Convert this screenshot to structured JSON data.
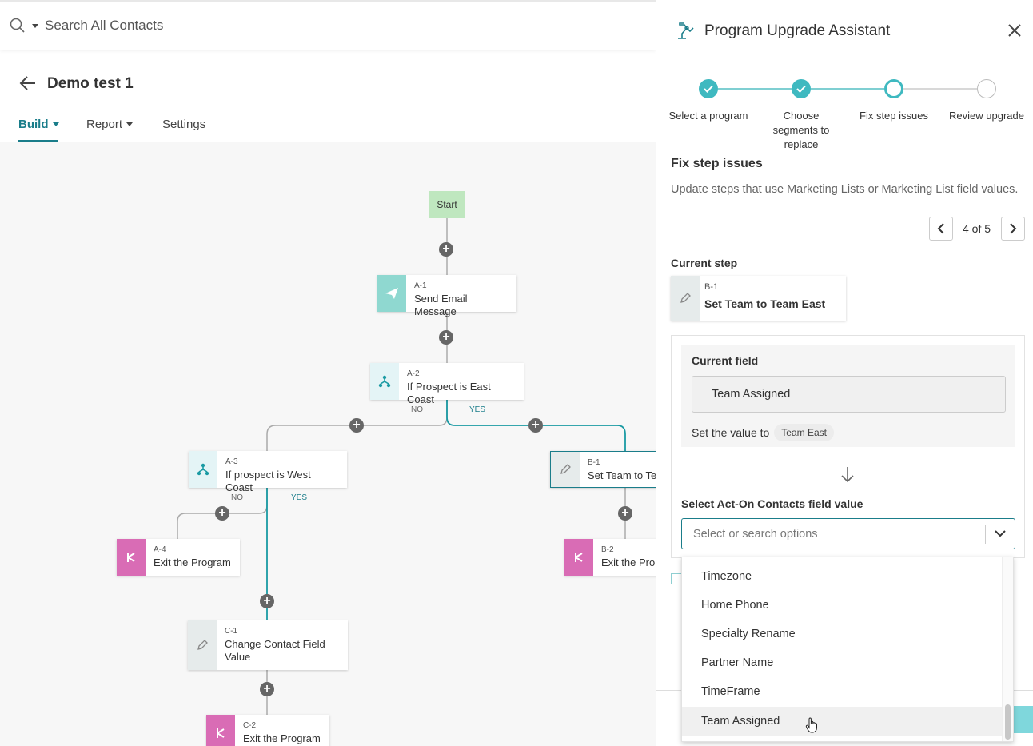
{
  "search": {
    "placeholder": "Search All Contacts"
  },
  "header": {
    "title": "Demo test 1",
    "tabs": [
      {
        "label": "Build",
        "active": true,
        "has_caret": true
      },
      {
        "label": "Report",
        "active": false,
        "has_caret": true
      },
      {
        "label": "Settings",
        "active": false,
        "has_caret": false
      }
    ]
  },
  "canvas": {
    "start_label": "Start",
    "nodes": [
      {
        "id": "A-1",
        "label": "Send Email Message",
        "icon": "paper-plane-icon"
      },
      {
        "id": "A-2",
        "label": "If Prospect is East Coast",
        "icon": "branch-icon"
      },
      {
        "id": "A-3",
        "label": "If prospect is West Coast",
        "icon": "branch-icon"
      },
      {
        "id": "A-4",
        "label": "Exit the Program",
        "icon": "exit-icon"
      },
      {
        "id": "B-1",
        "label": "Set Team to Te",
        "icon": "pencil-icon"
      },
      {
        "id": "B-2",
        "label": "Exit the Pro",
        "icon": "exit-icon"
      },
      {
        "id": "C-1",
        "label": "Change Contact Field Value",
        "icon": "pencil-icon"
      },
      {
        "id": "C-2",
        "label": "Exit the Program",
        "icon": "exit-icon"
      }
    ],
    "branch_labels": {
      "no": "NO",
      "yes": "YES"
    }
  },
  "panel": {
    "title": "Program Upgrade Assistant",
    "steps": [
      {
        "label": "Select a program",
        "state": "done"
      },
      {
        "label": "Choose segments to replace",
        "state": "done"
      },
      {
        "label": "Fix step issues",
        "state": "current"
      },
      {
        "label": "Review upgrade",
        "state": "todo"
      }
    ],
    "section_title": "Fix step issues",
    "section_desc": "Update steps that use Marketing Lists or Marketing List field values.",
    "pager": {
      "text": "4 of 5"
    },
    "current_step_label": "Current step",
    "current_step": {
      "id": "B-1",
      "label": "Set Team to Team East"
    },
    "current_field_label": "Current field",
    "current_field_value": "Team Assigned",
    "set_value_text": "Set the value to",
    "set_value_pill": "Team East",
    "select_label": "Select Act-On Contacts field value",
    "select_placeholder": "Select or search options",
    "dropdown_options": [
      "Timezone",
      "Home Phone",
      "Specialty Rename",
      "Partner Name",
      "TimeFrame",
      "Team Assigned"
    ],
    "highlighted_option": "Team Assigned"
  },
  "colors": {
    "accent": "#1a7d8a",
    "teal_step": "#3fb9c0",
    "exit_pink": "#d96cb5",
    "start_green": "#bfe7bf"
  }
}
